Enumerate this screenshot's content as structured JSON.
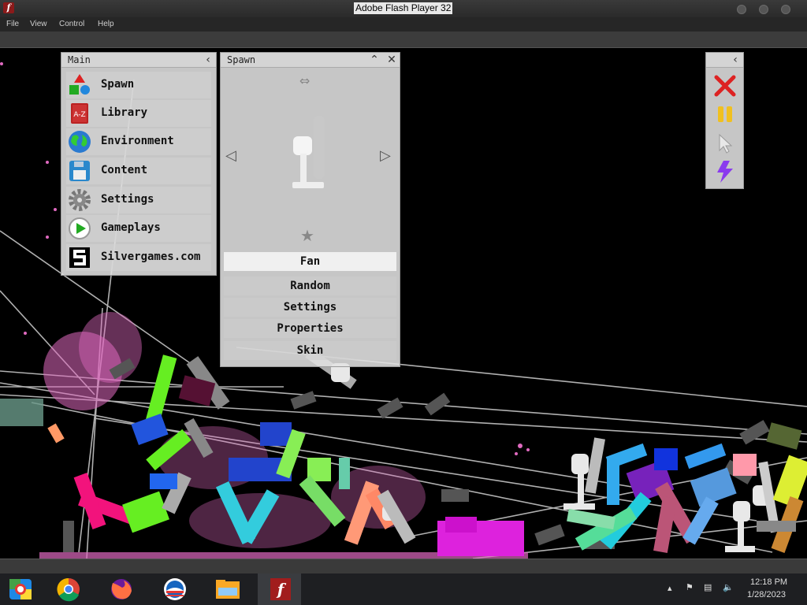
{
  "window": {
    "title": "Adobe Flash Player 32",
    "app_icon": "f"
  },
  "menu": [
    "File",
    "View",
    "Control",
    "Help"
  ],
  "main_panel": {
    "title": "Main",
    "items": [
      {
        "label": "Spawn",
        "icon": "shapes-icon"
      },
      {
        "label": "Library",
        "icon": "book-icon",
        "badge": "A-Z"
      },
      {
        "label": "Environment",
        "icon": "globe-icon"
      },
      {
        "label": "Content",
        "icon": "floppy-disk-icon"
      },
      {
        "label": "Settings",
        "icon": "gear-icon"
      },
      {
        "label": "Gameplays",
        "icon": "play-icon"
      },
      {
        "label": "Silvergames.com",
        "icon": "silvergames-logo-icon"
      }
    ]
  },
  "spawn_panel": {
    "title": "Spawn",
    "selected": "Fan",
    "options": [
      "Random",
      "Settings",
      "Properties",
      "Skin"
    ]
  },
  "tool_panel": {
    "tools": [
      "delete-x-icon",
      "pause-icon",
      "pointer-icon",
      "lightning-icon"
    ]
  },
  "taskbar": {
    "apps": [
      "explorer-ie-icon",
      "chrome-icon",
      "firefox-icon",
      "obama-logo-icon",
      "file-explorer-icon",
      "flash-player-icon"
    ],
    "time": "12:18 PM",
    "date": "1/28/2023"
  }
}
